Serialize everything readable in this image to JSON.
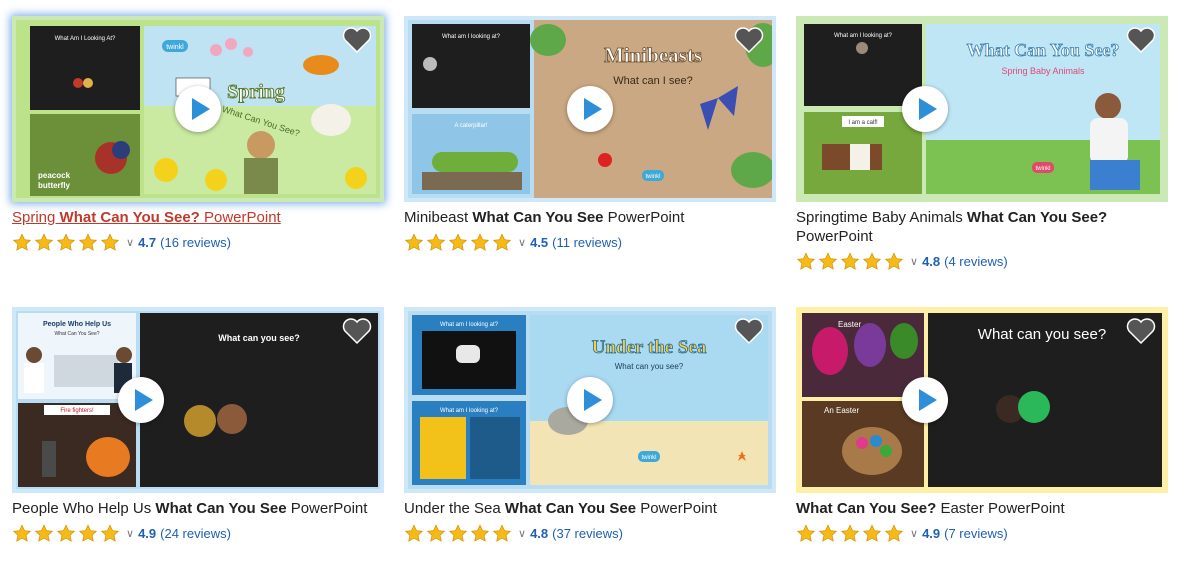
{
  "products": [
    {
      "title_parts": [
        "Spring ",
        "What Can You See?",
        " PowerPoint"
      ],
      "rating": "4.7",
      "reviews": "(16 reviews)",
      "stars": 5,
      "thumb_text": [
        "What Am I Looking At?",
        "peacock butterfly",
        "Spring",
        "What Can You See?",
        "twinkl"
      ]
    },
    {
      "title_parts": [
        "Minibeast ",
        "What Can You See",
        " PowerPoint"
      ],
      "rating": "4.5",
      "reviews": "(11 reviews)",
      "stars": 5,
      "thumb_text": [
        "What am I looking at?",
        "A caterpillar!",
        "Minibeasts",
        "What can I see?",
        "twinkl"
      ]
    },
    {
      "title_parts": [
        "Springtime Baby Animals ",
        "What Can You See?",
        " PowerPoint"
      ],
      "rating": "4.8",
      "reviews": "(4 reviews)",
      "stars": 5,
      "thumb_text": [
        "What am I looking at?",
        "I am a calf!",
        "What Can You See?",
        "Spring Baby Animals",
        "twinkl"
      ]
    },
    {
      "title_parts": [
        "People Who Help Us ",
        "What Can You See",
        " PowerPoint"
      ],
      "rating": "4.9",
      "reviews": "(24 reviews)",
      "stars": 5,
      "thumb_text": [
        "People Who Help Us",
        "What Can You See?",
        "Fire fighters!",
        "What can you see?"
      ]
    },
    {
      "title_parts": [
        "Under the Sea ",
        "What Can You See",
        " PowerPoint"
      ],
      "rating": "4.8",
      "reviews": "(37 reviews)",
      "stars": 5,
      "thumb_text": [
        "What am I looking at?",
        "What am I looking at?",
        "Under the Sea",
        "What can you see?",
        "twinkl"
      ]
    },
    {
      "title_parts": [
        "",
        "What Can You See?",
        " Easter PowerPoint"
      ],
      "rating": "4.9",
      "reviews": "(7 reviews)",
      "stars": 5,
      "thumb_text": [
        "Easter",
        "An Easter",
        "What can you see?"
      ]
    }
  ],
  "colors": {
    "star": "#f7b916",
    "link_blue": "#1f5fb5",
    "hover_title": "#c0392b"
  },
  "icons": {
    "play": "play-icon",
    "favourite": "heart-icon",
    "star": "star-icon",
    "dropdown": "chevron-down-icon"
  }
}
